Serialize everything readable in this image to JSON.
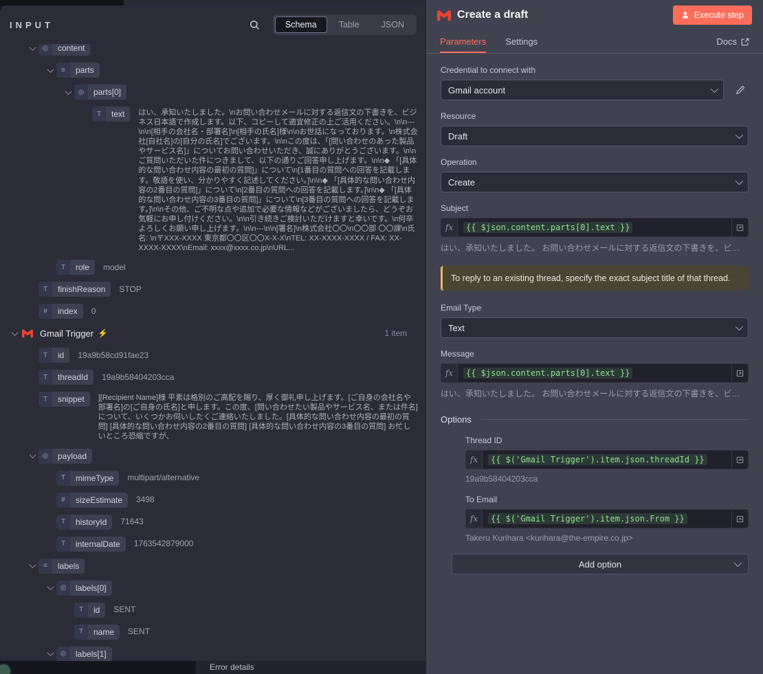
{
  "canvas": {
    "error_details_label": "Error details"
  },
  "input_panel": {
    "title": "INPUT",
    "tabs": [
      "Schema",
      "Table",
      "JSON"
    ],
    "active_tab": "Schema",
    "icons": {
      "string": "T",
      "number": "#",
      "list": "≡",
      "object": "◎",
      "bolt": "⚡"
    },
    "tree": [
      {
        "key": "content"
      },
      {
        "key": "parts"
      },
      {
        "key": "parts[0]"
      },
      {
        "key": "text",
        "value": "はい、承知いたしました。\\nお問い合わせメールに対する返信文の下書きを、ビジネス日本語で作成します。以下、コピーして適宜修正の上ご活用ください。\\n\\n---\\n\\n[相手の会社名・部署名]\\n[相手の氏名]様\\n\\nお世話になっております。\\n株式会社[自社名]の[自分の氏名]でございます。\\n\\nこの度は、「[問い合わせのあった製品やサービス名]」についてお問い合わせいただき、誠にありがとうございます。\\n\\nご質問いただいた件につきまして、以下の通りご回答申し上げます。\\n\\n◆ 「[具体的な問い合わせ内容の最初の質問]」について\\n[1番目の質問への回答を記載します。敬語を使い、分かりやすく記述してください。]\\n\\n◆ 「[具体的な問い合わせ内容の2番目の質問]」について\\n[2番目の質問への回答を記載します。]\\n\\n◆ 「[具体的な問い合わせ内容の3番目の質問]」について\\n[3番目の質問への回答を記載します。]\\n\\nその他、ご不明な点や追加で必要な情報などがございましたら、どうぞお気軽にお申し付けください。\\n\\n引き続きご検討いただけますと幸いです。\\n何卒よろしくお願い申し上げます。\\n\\n---\\n\\n[署名]\\n株式会社〇〇\\n〇〇部 〇〇課\\n氏名: \\n〒XXX-XXXX 東京都〇〇区〇〇X-X-X\\nTEL: XX-XXXX-XXXX / FAX: XX-XXXX-XXXX\\nEmail: xxxx@xxxx.co.jp\\nURL..."
      },
      {
        "key": "role",
        "value": "model"
      },
      {
        "key": "finishReason",
        "value": "STOP"
      },
      {
        "key": "index",
        "value": "0"
      },
      {
        "node": "Gmail Trigger",
        "item_count": "1 item"
      },
      {
        "key": "id",
        "value": "19a9b58cd91fae23"
      },
      {
        "key": "threadId",
        "value": "19a9b58404203cca"
      },
      {
        "key": "snippet",
        "value": "][Recipient Name]様 平素は格別のご高配を賜り、厚く御礼申し上げます。[ご自身の会社名や部署名]の[ご自身の氏名]と申します。この度、[問い合わせたい製品やサービス名、または件名]について、いくつかお伺いしたくご連絡いたしました。[具体的な問い合わせ内容の最初の質問] [具体的な問い合わせ内容の2番目の質問] [具体的な問い合わせ内容の3番目の質問] お忙しいところ恐縮ですが、"
      },
      {
        "key": "payload"
      },
      {
        "key": "mimeType",
        "value": "multipart/alternative"
      },
      {
        "key": "sizeEstimate",
        "value": "3498"
      },
      {
        "key": "historyId",
        "value": "71643"
      },
      {
        "key": "internalDate",
        "value": "1763542879000"
      },
      {
        "key": "labels"
      },
      {
        "key": "labels[0]"
      },
      {
        "key": "id",
        "value": "SENT"
      },
      {
        "key": "name",
        "value": "SENT"
      },
      {
        "key": "labels[1]"
      }
    ]
  },
  "ndv": {
    "title": "Create a draft",
    "execute_button_label": "Execute step",
    "tab_parameters": "Parameters",
    "tab_settings": "Settings",
    "docs_label": "Docs",
    "fx_label": "fx",
    "credential": {
      "label": "Credential to connect with",
      "value": "Gmail account"
    },
    "resource": {
      "label": "Resource",
      "value": "Draft"
    },
    "operation": {
      "label": "Operation",
      "value": "Create"
    },
    "subject": {
      "label": "Subject",
      "expression": "{{ $json.content.parts[0].text }}",
      "preview": "はい、承知いたしました。 お問い合わせメールに対する返信文の下書きを、ビ…"
    },
    "notice": "To reply to an existing thread, specify the exact subject title of that thread.",
    "email_type": {
      "label": "Email Type",
      "value": "Text"
    },
    "message": {
      "label": "Message",
      "expression": "{{ $json.content.parts[0].text }}",
      "preview": "はい、承知いたしました。 お問い合わせメールに対する返信文の下書きを、ビ…"
    },
    "options": {
      "label": "Options",
      "thread_id": {
        "label": "Thread ID",
        "expression": "{{ $('Gmail Trigger').item.json.threadId }}",
        "preview": "19a9b58404203cca"
      },
      "to_email": {
        "label": "To Email",
        "expression": "{{ $('Gmail Trigger').item.json.From }}",
        "preview": "Takeru Kurihara <kurihara@the-empire.co.jp>"
      },
      "add_option_label": "Add option"
    }
  }
}
